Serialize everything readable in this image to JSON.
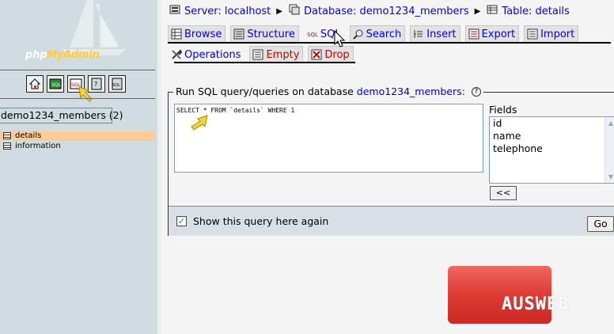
{
  "left_panel": {
    "logo": {
      "part1": "php",
      "part2": "MyAdmin"
    },
    "icons": [
      "home-icon",
      "query-window-icon",
      "sql-icon",
      "docs-icon",
      "sql-docs-icon"
    ],
    "database_select": {
      "value": "demo1234_members (2)"
    },
    "tables": [
      {
        "name": "details",
        "active": true
      },
      {
        "name": "information",
        "active": false
      }
    ]
  },
  "breadcrumb": {
    "server_label": "Server: localhost",
    "database_label": "Database: demo1234_members",
    "table_label": "Table: details"
  },
  "tabs": [
    {
      "label": "Browse",
      "icon": "browse-icon"
    },
    {
      "label": "Structure",
      "icon": "structure-icon"
    },
    {
      "label": "SQL",
      "icon": "sql-icon",
      "active": true
    },
    {
      "label": "Search",
      "icon": "search-icon"
    },
    {
      "label": "Insert",
      "icon": "insert-icon"
    },
    {
      "label": "Export",
      "icon": "export-icon"
    },
    {
      "label": "Import",
      "icon": "import-icon"
    },
    {
      "label": "Operations",
      "icon": "operations-icon"
    },
    {
      "label": "Empty",
      "icon": "empty-icon"
    },
    {
      "label": "Drop",
      "icon": "drop-icon"
    }
  ],
  "sql_panel": {
    "legend_prefix": "Run SQL query/queries on database",
    "database_link": "demo1234_members:",
    "query": "SELECT * FROM `details` WHERE 1",
    "fields_label": "Fields",
    "fields": [
      "id",
      "name",
      "telephone"
    ],
    "insert_button": "<<",
    "show_query_label": "Show this query here again",
    "show_query_checked": true,
    "go_button": "Go"
  },
  "watermark": {
    "text": "AUSWEB"
  },
  "colors": {
    "link": "#0000ee",
    "danger": "#cc0000",
    "left_bg": "#d0dce0",
    "active_row": "#ffcc99"
  }
}
